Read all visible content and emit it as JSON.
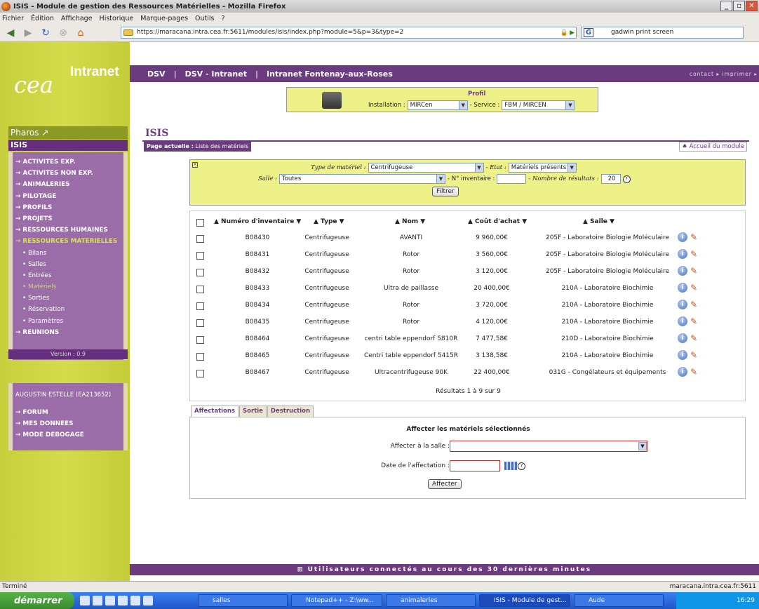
{
  "window": {
    "title": "ISIS - Module de gestion des Ressources Matérielles - Mozilla Firefox"
  },
  "menubar": [
    "Fichier",
    "Édition",
    "Affichage",
    "Historique",
    "Marque-pages",
    "Outils",
    "?"
  ],
  "nav": {
    "url": "https://maracana.intra.cea.fr:5611/modules/isis/index.php?module=5&p=3&type=2",
    "search": "gadwin print screen"
  },
  "sidebar": {
    "logo": "cea",
    "intranet": "Intranet",
    "pharos": "Pharos ↗",
    "isis": "ISIS",
    "items": [
      {
        "label": "→ ACTIVITES EXP."
      },
      {
        "label": "→ ACTIVITES NON EXP."
      },
      {
        "label": "→ ANIMALERIES"
      },
      {
        "label": "→ PILOTAGE"
      },
      {
        "label": "→ PROFILS"
      },
      {
        "label": "→ PROJETS"
      },
      {
        "label": "→ RESSOURCES HUMAINES"
      },
      {
        "label": "→ RESSOURCES MATERIELLES"
      }
    ],
    "subitems": [
      "• Bilans",
      "• Salles",
      "• Entrées",
      "• Matériels",
      "• Sorties",
      "• Réservation",
      "• Paramètres"
    ],
    "reunions": "→ REUNIONS",
    "version": "Version : 0.9",
    "user": "AUGUSTIN ESTELLE (EA213652)",
    "user_items": [
      "→ FORUM",
      "→ MES DONNEES",
      "→ MODE DEBOGAGE"
    ]
  },
  "topband": {
    "a": "DSV",
    "b": "DSV - Intranet",
    "c": "Intranet Fontenay-aux-Roses",
    "contact": "contact ▸ imprimer ▸"
  },
  "profil": {
    "title": "Profil",
    "installation_label": "Installation :",
    "installation": "MIRCen",
    "service_label": "- Service :",
    "service": "FBM / MIRCEN"
  },
  "page": {
    "title": "ISIS",
    "crumb_label": "Page actuelle :",
    "crumb": " Liste des matériels",
    "accueil": "♠ Accueil du module"
  },
  "filter": {
    "type_label": "Type de matériel :",
    "type_value": "Centrifugeuse",
    "etat_label": "- Etat :",
    "etat_value": "Matériels présents",
    "salle_label": "Salle :",
    "salle_value": "Toutes",
    "inv_label": "- N° inventaire :",
    "inv_value": "",
    "nb_label": "- Nombre de résultats :",
    "nb_value": "20",
    "button": "Filtrer"
  },
  "table": {
    "headers": [
      "▲ Numéro d'inventaire ▼",
      "▲ Type ▼",
      "▲ Nom ▼",
      "▲ Coût d'achat ▼",
      "▲ Salle ▼"
    ],
    "rows": [
      [
        "B08430",
        "Centrifugeuse",
        "AVANTI",
        "9 960,00€",
        "205F - Laboratoire Biologie Moléculaire"
      ],
      [
        "B08431",
        "Centrifugeuse",
        "Rotor",
        "3 560,00€",
        "205F - Laboratoire Biologie Moléculaire"
      ],
      [
        "B08432",
        "Centrifugeuse",
        "Rotor",
        "3 120,00€",
        "205F - Laboratoire Biologie Moléculaire"
      ],
      [
        "B08433",
        "Centrifugeuse",
        "Ultra de paillasse",
        "20 400,00€",
        "210A - Laboratoire Biochimie"
      ],
      [
        "B08434",
        "Centrifugeuse",
        "Rotor",
        "3 720,00€",
        "210A - Laboratoire Biochimie"
      ],
      [
        "B08435",
        "Centrifugeuse",
        "Rotor",
        "4 120,00€",
        "210A - Laboratoire Biochimie"
      ],
      [
        "B08464",
        "Centrifugeuse",
        "centri table eppendorf 5810R",
        "7 477,58€",
        "210D - Laboratoire Biochimie"
      ],
      [
        "B08465",
        "Centrifugeuse",
        "Centri table eppendorf 5415R",
        "3 138,58€",
        "210A - Laboratoire Biochimie"
      ],
      [
        "B08467",
        "Centrifugeuse",
        "Ultracentrifugeuse 90K",
        "22 400,00€",
        "031G - Congélateurs et équipements"
      ]
    ],
    "results": "Résultats 1 à 9 sur 9"
  },
  "tabs": [
    "Affectations",
    "Sortie",
    "Destruction"
  ],
  "panel": {
    "title": "Affecter les matériels sélectionnés",
    "salle_label": "Affecter à la salle :",
    "date_label": "Date de l'affectation :",
    "button": "Affecter"
  },
  "footer": "⊞ Utilisateurs connectés au cours des 30 dernières minutes",
  "status": {
    "left": "Terminé",
    "right": "maracana.intra.cea.fr:5611"
  },
  "taskbar": {
    "start": "démarrer",
    "items": [
      "salles",
      "Notepad++ - Z:\\ww...",
      "animaleries",
      "ISIS - Module de gest...",
      "Aude"
    ],
    "clock": "16:29"
  }
}
